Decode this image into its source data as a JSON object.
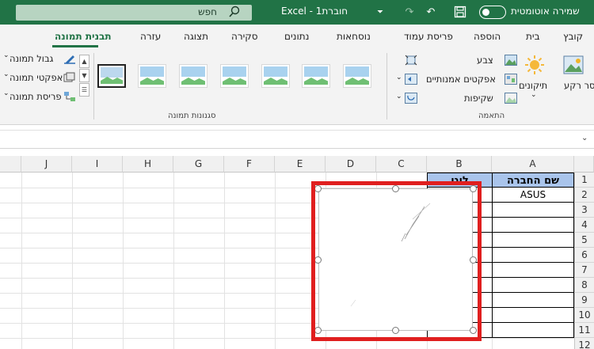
{
  "titlebar": {
    "autosave_label": "שמירה אוטומטית",
    "doc_title": "חוברת1 - Excel",
    "search_placeholder": "חפש",
    "icons": [
      "save-icon",
      "undo-icon",
      "redo-icon",
      "touch-mode-icon",
      "dropdown-icon",
      "search-icon"
    ]
  },
  "ribbon_tabs": [
    "קובץ",
    "בית",
    "הוספה",
    "פריסת עמוד",
    "נוסחאות",
    "נתונים",
    "סקירה",
    "תצוגה",
    "עזרה",
    "תבנית תמונה"
  ],
  "active_tab": "תבנית תמונה",
  "ribbon": {
    "adjust": {
      "group_label": "התאמה",
      "remove_background": "הסר רקע",
      "corrections": "תיקונים",
      "color": "צבע",
      "artistic_effects": "אפקטים אמנותיים",
      "transparency": "שקיפות"
    },
    "picture_styles": {
      "group_label": "סגנונות תמונה",
      "thumbnail_count": 7,
      "selected_index": 0,
      "picture_border": "גבול תמונה",
      "picture_effects": "אפקטי תמונה",
      "picture_layout": "פריסת תמונה"
    }
  },
  "grid": {
    "columns": [
      "A",
      "B",
      "C",
      "D",
      "E",
      "F",
      "G",
      "H",
      "I",
      "J"
    ],
    "rows": [
      "1",
      "2",
      "3",
      "4",
      "5",
      "6",
      "7",
      "8",
      "9",
      "10",
      "11",
      "12"
    ],
    "cells": {
      "A1": "שם החברה",
      "B1": "לוגו",
      "A2": "ASUS"
    }
  },
  "colors": {
    "excel_green": "#217346",
    "header_fill": "#a9c4eb",
    "highlight_red": "#e01f1f"
  }
}
